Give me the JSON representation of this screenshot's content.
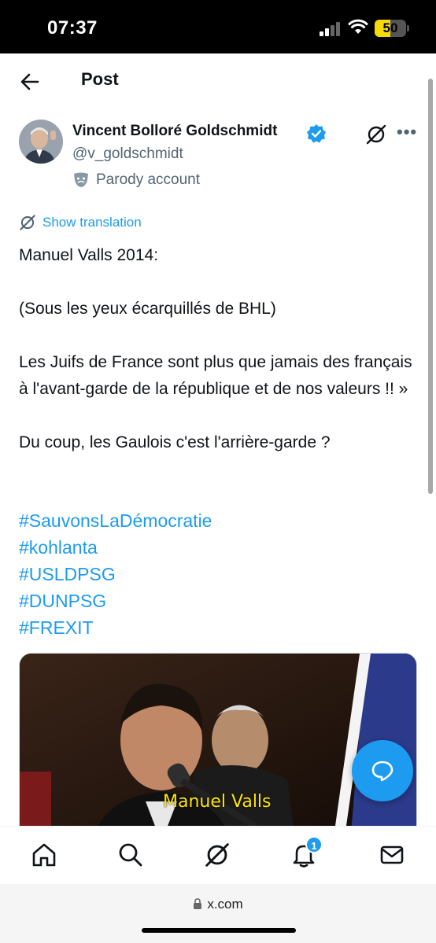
{
  "status_bar": {
    "time": "07:37",
    "battery": "50",
    "battery_level": 0.5
  },
  "header": {
    "title": "Post"
  },
  "author": {
    "name": "Vincent Bolloré Goldschmidt",
    "handle": "@v_goldschmidt",
    "label": "Parody account"
  },
  "translation": {
    "label": "Show translation"
  },
  "post": {
    "paragraphs": [
      "Manuel Valls 2014:",
      "",
      "(Sous les yeux écarquillés de BHL)",
      "",
      "Les Juifs de France sont plus que jamais des français à l'avant-garde de la république et de nos valeurs !! »",
      "",
      "Du coup, les Gaulois c'est l'arrière-garde ?",
      ""
    ],
    "hashtags": [
      "#SauvonsLaDémocratie",
      "#kohlanta",
      "#USLDPSG",
      "#DUNPSG",
      "#FREXIT"
    ]
  },
  "media": {
    "caption": "Manuel Valls"
  },
  "nav": {
    "notification_count": "1"
  },
  "browser": {
    "url": "x.com"
  },
  "colors": {
    "accent": "#1d9bf0",
    "text": "#0f1419",
    "secondary": "#536471"
  }
}
